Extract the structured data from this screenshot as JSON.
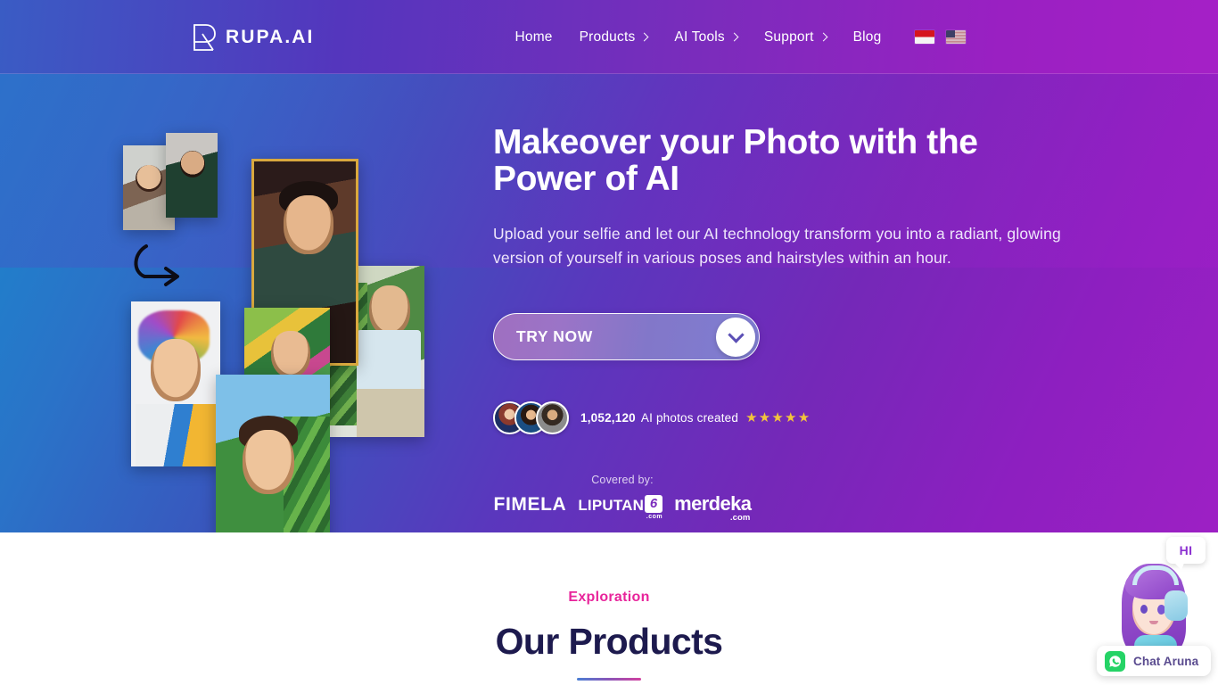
{
  "brand": {
    "name": "RUPA.AI",
    "logo_icon": "rupa-logo-icon"
  },
  "nav": {
    "items": [
      {
        "label": "Home",
        "has_caret": false
      },
      {
        "label": "Products",
        "has_caret": true
      },
      {
        "label": "AI Tools",
        "has_caret": true
      },
      {
        "label": "Support",
        "has_caret": true
      },
      {
        "label": "Blog",
        "has_caret": false
      }
    ],
    "flags": [
      {
        "name": "flag-indonesia",
        "alt": "Indonesia"
      },
      {
        "name": "flag-united-states",
        "alt": "United States"
      }
    ]
  },
  "hero": {
    "headline": "Makeover your Photo with the Power of AI",
    "subheadline": "Upload your selfie and let our AI technology transform you into a radiant, glowing version of yourself in various poses and hairstyles within an hour.",
    "cta": {
      "label": "TRY NOW",
      "icon": "chevron-down-icon"
    },
    "social_proof": {
      "count": "1,052,120",
      "text": "AI photos created",
      "stars": 5,
      "star_color": "#f2c43c",
      "avatar_count": 3
    },
    "press": {
      "label": "Covered by:",
      "logos": [
        {
          "name": "fimela",
          "text": "FIMELA"
        },
        {
          "name": "liputan6",
          "text": "LIPUTAN",
          "mark": "6",
          "sub": ".com"
        },
        {
          "name": "merdeka",
          "text": "merdeka",
          "sub": ".com"
        }
      ]
    },
    "collage": {
      "arrow_icon": "curved-arrow-icon",
      "photo_count": 7
    }
  },
  "products_section": {
    "eyebrow": "Exploration",
    "title": "Our Products"
  },
  "chat_widget": {
    "bubble_text": "HI",
    "button_label": "Chat Aruna",
    "icon": "whatsapp-icon",
    "avatar_name": "aruna-avatar"
  },
  "colors": {
    "header_start": "#3a5cc4",
    "header_end": "#a520c6",
    "hero_start": "#1889cd",
    "hero_end": "#9d20c4",
    "accent_pink": "#e8249b",
    "title_navy": "#1d1a4e",
    "star_gold": "#f2c43c",
    "whatsapp_green": "#25d366"
  }
}
